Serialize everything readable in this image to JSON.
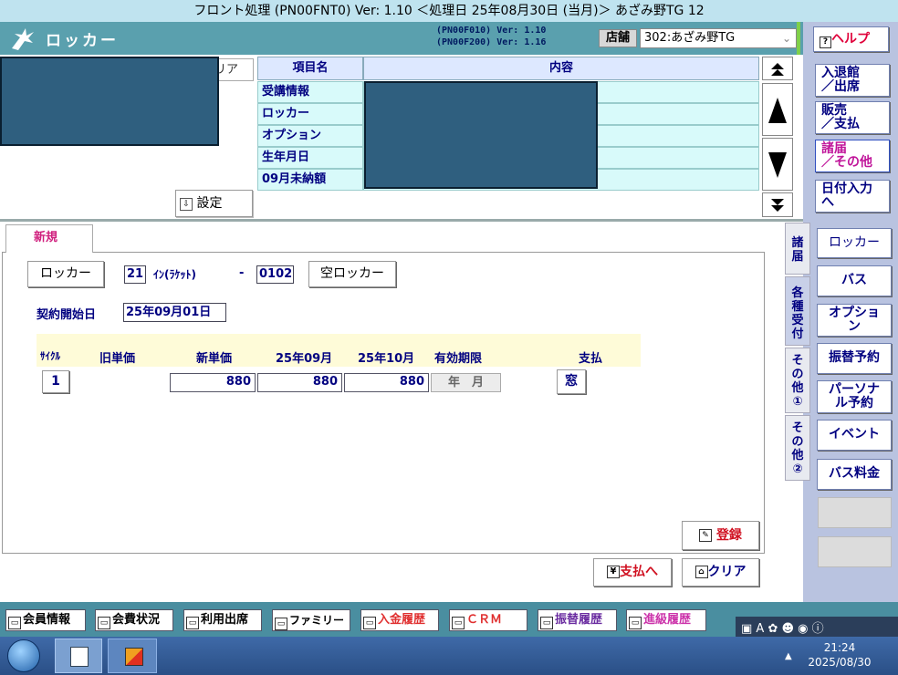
{
  "window": {
    "title": "フロント処理 (PN00FNT0) Ver: 1.10 ＜処理日 25年08月30日 (当月)＞ あざみ野TG 12"
  },
  "header": {
    "app_name": "ロッカー",
    "version_line_1": "(PN00F010)  Ver: 1.10",
    "version_line_2": "(PN00F200)  Ver: 1.16",
    "store_label": "店舗",
    "store_value": "302:あざみ野TG"
  },
  "right_menu": {
    "help": "ヘルプ",
    "items": [
      {
        "label": "入退館\n／出席"
      },
      {
        "label": "販売\n／支払"
      },
      {
        "label": "諸届\n／その他"
      },
      {
        "label": "日付入力\nへ"
      }
    ],
    "sub_items": [
      "ロッカー",
      "バス",
      "オプショ\nン",
      "振替予約",
      "パーソナ\nル予約",
      "イベント",
      "バス料金",
      "",
      ""
    ]
  },
  "info_panel": {
    "clear_label": "リア",
    "header_item": "項目名",
    "header_content": "内容",
    "rows": [
      "受講情報",
      "ロッカー",
      "オプション",
      "生年月日",
      "09月未納額"
    ],
    "settings_label": "設定"
  },
  "side_tabs": [
    "諸\n届",
    "各\n種\n受\n付",
    "そ\nの\n他\n①",
    "そ\nの\n他\n②"
  ],
  "form": {
    "tab_label": "新規",
    "locker_button": "ロッカー",
    "locker_no": "21",
    "locker_type": "ｲﾝ(ﾗｹｯﾄ)",
    "dash": "-",
    "locker_code": "0102",
    "empty_locker_button": "空ロッカー",
    "start_date_label": "契約開始日",
    "start_date_value": "25年09月01日",
    "grid": {
      "headers": [
        "ｻｲｸﾙ",
        "旧単価",
        "新単価",
        "25年09月",
        "25年10月",
        "有効期限",
        "支払"
      ],
      "row": {
        "cycle": "1",
        "old_price": "",
        "new_price": "880",
        "m1": "880",
        "m2": "880",
        "expiry": "年　月",
        "payment": "窓"
      }
    },
    "register_button": "登録"
  },
  "footer_actions": {
    "to_payment": "支払へ",
    "clear": "クリア"
  },
  "bottom_bar": [
    "会員情報",
    "会費状況",
    "利用出席",
    "ファミリー",
    "入金履歴",
    "ＣＲＭ",
    "振替履歴",
    "進級履歴"
  ],
  "taskbar": {
    "time": "21:24",
    "date": "2025/08/30"
  }
}
